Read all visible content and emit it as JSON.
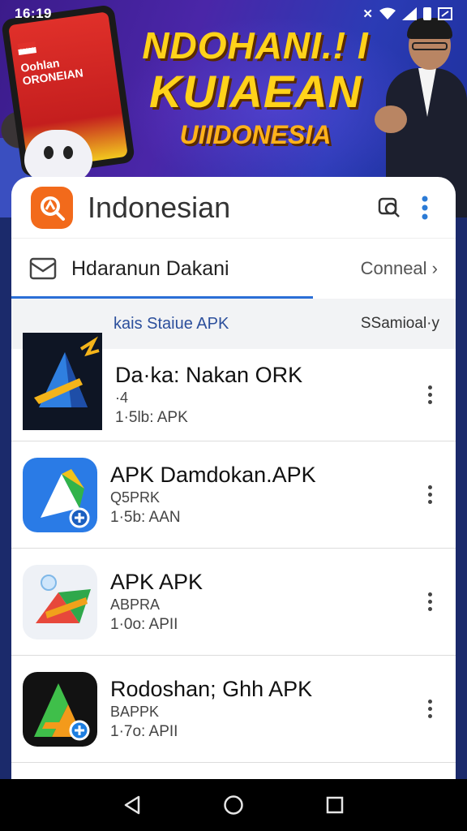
{
  "status_bar": {
    "time": "16:19"
  },
  "banner": {
    "line1": "NDOHANI.! I",
    "line2": "KUIAEAN",
    "line3": "UIIDONESIA",
    "phone_text": "Oohlan ORONEIAN"
  },
  "header": {
    "title": "Indonesian",
    "icons": [
      "search-refresh-icon",
      "more-vert-icon"
    ]
  },
  "tabs": {
    "active_label": "Hdaranun Dakani",
    "active_icon": "mail-icon",
    "link_label": "Conneal"
  },
  "section": {
    "title": "kais Staiue APK",
    "sort_label": "SSamioal·y"
  },
  "apps": [
    {
      "name": "Da·ka: Nakan ORK",
      "sub": "·4",
      "meta": "1·5lb: APK",
      "icon": "triangle-app-icon-dark"
    },
    {
      "name": "APK Damdokan.APK",
      "sub": "Q5PRK",
      "meta": "1·5b: AAN",
      "icon": "triangle-app-icon-blue"
    },
    {
      "name": "APK APK",
      "sub": "ABPRA",
      "meta": "1·0o: APII",
      "icon": "triangle-app-icon-light"
    },
    {
      "name": "Rodoshan; Ghh APK",
      "sub": "BAPPK",
      "meta": "1·7o: APII",
      "icon": "triangle-app-icon-black"
    }
  ],
  "nav": {
    "buttons": [
      "back-icon",
      "home-icon",
      "recents-icon"
    ]
  },
  "colors": {
    "accent": "#2b6fd6",
    "logo": "#f26a1b",
    "banner_text": "#ffd21a"
  }
}
